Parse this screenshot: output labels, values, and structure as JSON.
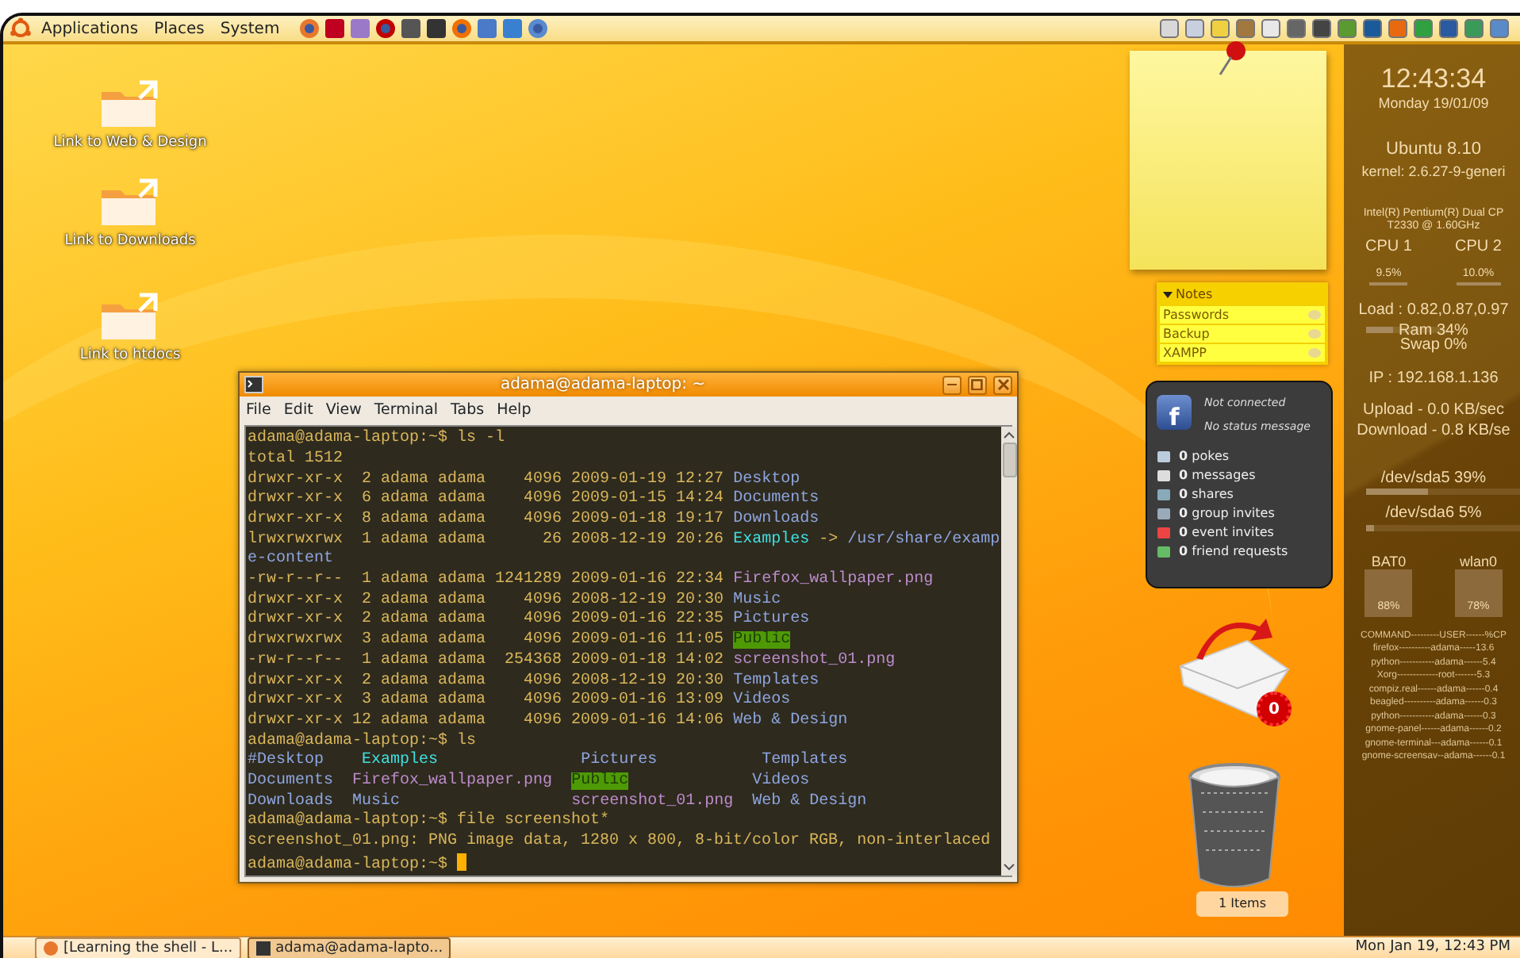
{
  "top_panel": {
    "menus": [
      "Applications",
      "Places",
      "System"
    ]
  },
  "desktop_icons": [
    {
      "label": "Link to Web & Design"
    },
    {
      "label": "Link to Downloads"
    },
    {
      "label": "Link to htdocs"
    }
  ],
  "terminal": {
    "title": "adama@adama-laptop: ~",
    "menu": [
      "File",
      "Edit",
      "View",
      "Terminal",
      "Tabs",
      "Help"
    ],
    "lines": [
      [
        {
          "kind": "plain",
          "text": "adama@adama-laptop:~$ ls -l"
        }
      ],
      [
        {
          "kind": "plain",
          "text": "total 1512"
        }
      ],
      [
        {
          "kind": "plain",
          "text": "drwxr-xr-x  2 adama adama    4096 2009-01-19 12:27 "
        },
        {
          "kind": "dir",
          "text": "Desktop"
        }
      ],
      [
        {
          "kind": "plain",
          "text": "drwxr-xr-x  6 adama adama    4096 2009-01-15 14:24 "
        },
        {
          "kind": "dir",
          "text": "Documents"
        }
      ],
      [
        {
          "kind": "plain",
          "text": "drwxr-xr-x  8 adama adama    4096 2009-01-18 19:17 "
        },
        {
          "kind": "dir",
          "text": "Downloads"
        }
      ],
      [
        {
          "kind": "plain",
          "text": "lrwxrwxrwx  1 adama adama      26 2008-12-19 20:26 "
        },
        {
          "kind": "link",
          "text": "Examples"
        },
        {
          "kind": "plain",
          "text": " -> "
        },
        {
          "kind": "dir",
          "text": "/usr/share/examp"
        }
      ],
      [
        {
          "kind": "dir",
          "text": "e-content"
        }
      ],
      [
        {
          "kind": "plain",
          "text": "-rw-r--r--  1 adama adama 1241289 2009-01-16 22:34 "
        },
        {
          "kind": "image",
          "text": "Firefox_wallpaper.png"
        }
      ],
      [
        {
          "kind": "plain",
          "text": "drwxr-xr-x  2 adama adama    4096 2008-12-19 20:30 "
        },
        {
          "kind": "dir",
          "text": "Music"
        }
      ],
      [
        {
          "kind": "plain",
          "text": "drwxr-xr-x  2 adama adama    4096 2009-01-16 22:35 "
        },
        {
          "kind": "dir",
          "text": "Pictures"
        }
      ],
      [
        {
          "kind": "plain",
          "text": "drwxrwxrwx  3 adama adama    4096 2009-01-16 11:05 "
        },
        {
          "kind": "public",
          "text": "Public"
        }
      ],
      [
        {
          "kind": "plain",
          "text": "-rw-r--r--  1 adama adama  254368 2009-01-18 14:02 "
        },
        {
          "kind": "image",
          "text": "screenshot_01.png"
        }
      ],
      [
        {
          "kind": "plain",
          "text": "drwxr-xr-x  2 adama adama    4096 2008-12-19 20:30 "
        },
        {
          "kind": "dir",
          "text": "Templates"
        }
      ],
      [
        {
          "kind": "plain",
          "text": "drwxr-xr-x  3 adama adama    4096 2009-01-16 13:09 "
        },
        {
          "kind": "dir",
          "text": "Videos"
        }
      ],
      [
        {
          "kind": "plain",
          "text": "drwxr-xr-x 12 adama adama    4096 2009-01-16 14:06 "
        },
        {
          "kind": "dir",
          "text": "Web & Design"
        }
      ],
      [
        {
          "kind": "plain",
          "text": "adama@adama-laptop:~$ ls"
        }
      ],
      [
        {
          "kind": "dir",
          "text": "#Desktop    "
        },
        {
          "kind": "link",
          "text": "Examples               "
        },
        {
          "kind": "dir",
          "text": "Pictures           "
        },
        {
          "kind": "dir",
          "text": "Templates"
        }
      ],
      [
        {
          "kind": "dir",
          "text": "Documents  "
        },
        {
          "kind": "image",
          "text": "Firefox_wallpaper.png  "
        },
        {
          "kind": "public",
          "text": "Public"
        },
        {
          "kind": "dir",
          "text": "             Videos"
        }
      ],
      [
        {
          "kind": "dir",
          "text": "Downloads  "
        },
        {
          "kind": "dir",
          "text": "Music                  "
        },
        {
          "kind": "image",
          "text": "screenshot_01.png  "
        },
        {
          "kind": "dir",
          "text": "Web & Design"
        }
      ],
      [
        {
          "kind": "plain",
          "text": "adama@adama-laptop:~$ file screenshot*"
        }
      ],
      [
        {
          "kind": "plain",
          "text": "screenshot_01.png: PNG image data, 1280 x 800, 8-bit/color RGB, non-interlaced"
        }
      ],
      [
        {
          "kind": "plain",
          "text": "adama@adama-laptop:~$ "
        }
      ]
    ],
    "cursor": true
  },
  "notes": {
    "title": "Notes",
    "expanded": true,
    "items": [
      "Passwords",
      "Backup",
      "XAMPP"
    ]
  },
  "facebook": {
    "logo": "f",
    "status": [
      "Not connected",
      "No status message"
    ],
    "counts": [
      "**0** pokes",
      "**0** messages",
      "**0** shares",
      "**0** group invites",
      "**0** event invites",
      "**0** friend requests"
    ]
  },
  "mail": {
    "badge": "0"
  },
  "trash": {
    "label": "1 Items"
  },
  "conky": {
    "time": "12:43:34",
    "date": "Monday 19/01/09",
    "os": "Ubuntu 8.10",
    "kernel": "kernel: 2.6.27-9-generi",
    "cpu_model": [
      "Intel(R) Pentium(R) Dual  CP",
      "T2330  @ 1.60GHz"
    ],
    "cpus": [
      {
        "name": "CPU 1",
        "reading": "9.5%"
      },
      {
        "name": "CPU 2",
        "reading": "10.0%"
      }
    ],
    "load": "Load : 0.82,0.87,0.97",
    "ram": {
      "label": "Ram 34%",
      "level": 0.34
    },
    "swap": "Swap 0%",
    "ip": "IP : 192.168.1.136",
    "upload": "Upload - 0.0 KB/sec",
    "download": "Download - 0.8 KB/se",
    "disks": [
      {
        "label": "/dev/sda5 39%",
        "level": 0.39
      },
      {
        "label": "/dev/sda6 5%",
        "level": 0.05
      }
    ],
    "meters": [
      {
        "name": "BAT0",
        "reading": "88%"
      },
      {
        "name": "wlan0",
        "reading": "78%"
      }
    ],
    "processes": [
      "COMMAND---------USER------%CP",
      "firefox----------adama-----13.6",
      "python-----------adama------5.4",
      "Xorg-------------root-------5.3",
      "compiz.real------adama------0.4",
      "beagled----------adama------0.3",
      "python-----------adama------0.3",
      "gnome-panel------adama------0.2",
      "gnome-terminal---adama------0.1",
      "gnome-screensav--adama------0.1"
    ]
  },
  "taskbar": {
    "tasks": [
      {
        "label": "[Learning the shell - L...",
        "selected": false
      },
      {
        "label": "adama@adama-lapto...",
        "selected": true
      }
    ],
    "clock": "Mon Jan 19, 12:43 PM"
  }
}
